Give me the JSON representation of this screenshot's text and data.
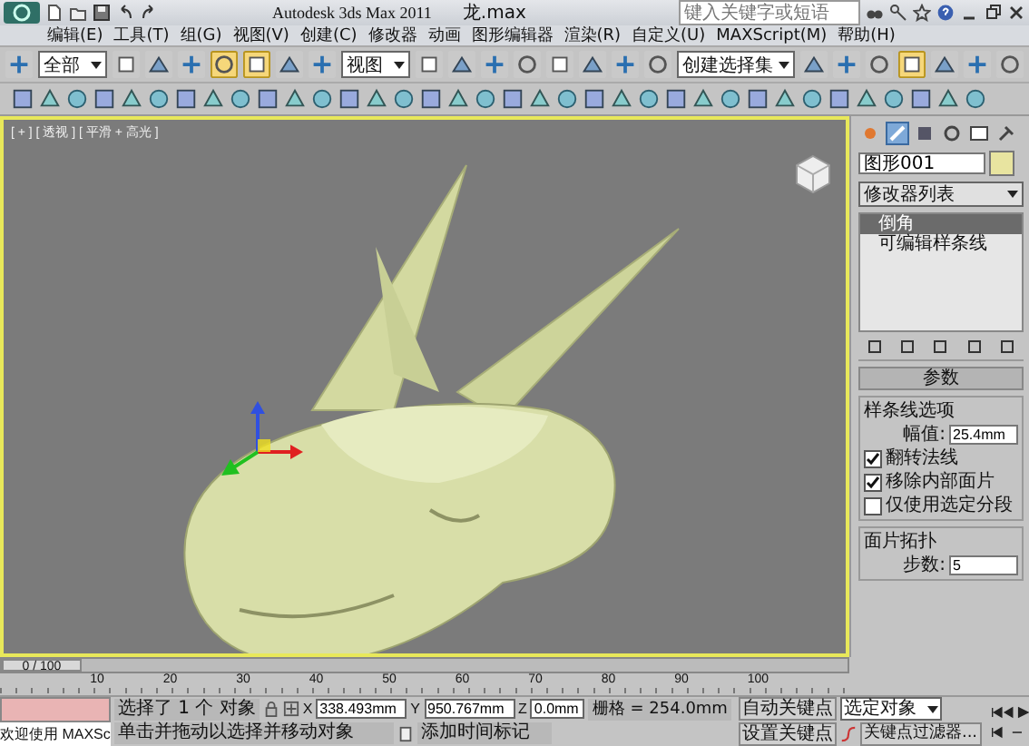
{
  "title_bar": {
    "app_title": "Autodesk 3ds Max  2011",
    "file_name": "龙.max",
    "search": {
      "placeholder": "键入关键字或短语"
    }
  },
  "menu": [
    "编辑(E)",
    "工具(T)",
    "组(G)",
    "视图(V)",
    "创建(C)",
    "修改器",
    "动画",
    "图形编辑器",
    "渲染(R)",
    "自定义(U)",
    "MAXScript(M)",
    "帮助(H)"
  ],
  "toolbar_1": [
    {
      "kind": "tool",
      "selected": false
    },
    {
      "kind": "dropdown",
      "value": "全部"
    },
    {
      "kind": "tool",
      "selected": false
    },
    {
      "kind": "tool",
      "selected": false
    },
    {
      "kind": "tool",
      "selected": false
    },
    {
      "kind": "tool",
      "selected": true
    },
    {
      "kind": "tool",
      "selected": true
    },
    {
      "kind": "tool",
      "selected": false
    },
    {
      "kind": "tool",
      "selected": false
    },
    {
      "kind": "dropdown",
      "value": "视图"
    },
    {
      "kind": "tool",
      "selected": false
    },
    {
      "kind": "tool",
      "selected": false
    },
    {
      "kind": "tool",
      "selected": false
    },
    {
      "kind": "tool",
      "selected": false
    },
    {
      "kind": "tool",
      "selected": false
    },
    {
      "kind": "tool",
      "selected": false
    },
    {
      "kind": "tool",
      "selected": false
    },
    {
      "kind": "tool",
      "selected": false
    },
    {
      "kind": "dropdown",
      "value": "创建选择集"
    },
    {
      "kind": "tool",
      "selected": false
    },
    {
      "kind": "tool",
      "selected": false
    },
    {
      "kind": "tool",
      "selected": false
    },
    {
      "kind": "tool",
      "selected": true
    },
    {
      "kind": "tool",
      "selected": false
    },
    {
      "kind": "tool",
      "selected": false
    },
    {
      "kind": "tool",
      "selected": false
    }
  ],
  "viewport": {
    "label": "[ + ] [ 透视 ] [ 平滑 + 高光 ]"
  },
  "command_panel": {
    "tabs": [
      {
        "selected": false
      },
      {
        "selected": true
      },
      {
        "selected": false
      },
      {
        "selected": false
      },
      {
        "selected": false
      },
      {
        "selected": false
      }
    ],
    "object_name": "图形001",
    "modifier_list": "修改器列表",
    "stack": [
      {
        "label": "倒角",
        "selected": true
      },
      {
        "label": "可编辑样条线",
        "selected": false
      }
    ],
    "rollout_title": "参数",
    "spline_group": {
      "title": "样条线选项",
      "amount_label": "幅值:",
      "amount_value": "25.4mm",
      "options": [
        {
          "label": "翻转法线",
          "checked": true
        },
        {
          "label": "移除内部面片",
          "checked": true
        },
        {
          "label": "仅使用选定分段",
          "checked": false
        }
      ]
    },
    "patch_group": {
      "title": "面片拓扑",
      "steps_label": "步数:",
      "steps_value": "5"
    }
  },
  "time_slider": {
    "label": "0 / 100",
    "level": 0
  },
  "ruler": [
    "10",
    "20",
    "30",
    "40",
    "50",
    "60",
    "70",
    "80",
    "90",
    "100"
  ],
  "status_bar": {
    "welcome": "欢迎使用 MAXSc",
    "selection": "选择了 1 个 对象",
    "prompt": "单击并拖动以选择并移动对象",
    "x_label": "X",
    "x": "338.493mm",
    "y_label": "Y",
    "y": "950.767mm",
    "z_label": "Z",
    "z": "0.0mm",
    "grid": "栅格 = 254.0mm",
    "add_time_tag": "添加时间标记",
    "auto_key": "自动关键点",
    "set_key": "设置关键点",
    "key_mode": "选定对象",
    "key_filters": "关键点过滤器..."
  }
}
